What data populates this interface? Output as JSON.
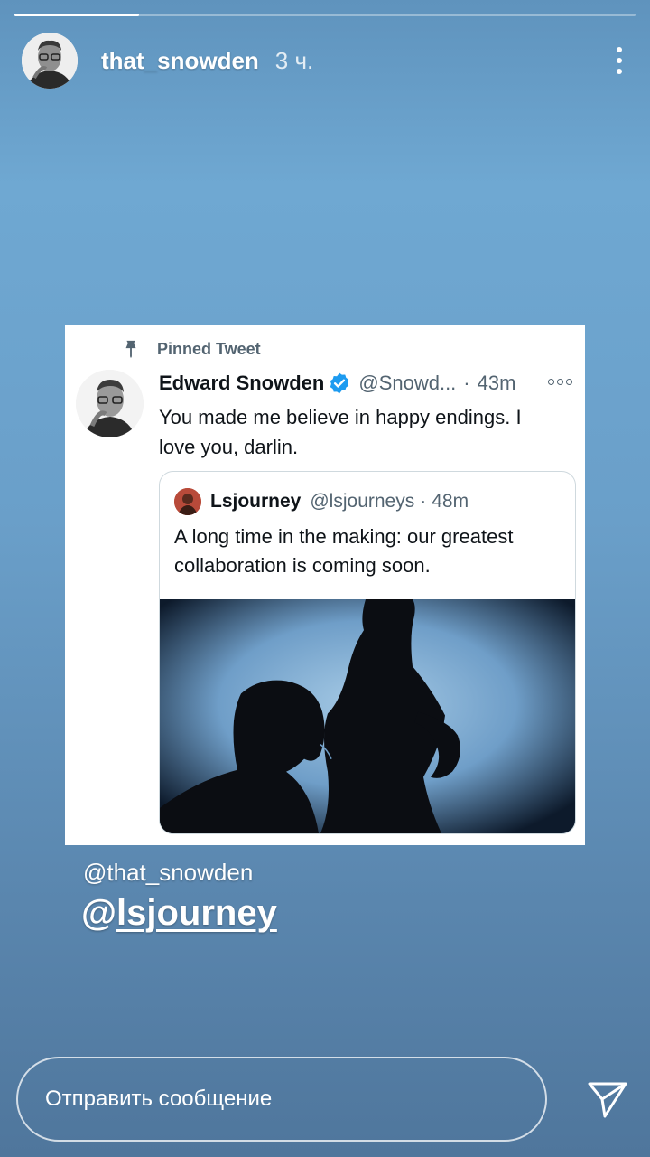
{
  "story": {
    "progress": 0.2
  },
  "header": {
    "username": "that_snowden",
    "time": "3 ч."
  },
  "tweet": {
    "pinned_label": "Pinned Tweet",
    "name": "Edward Snowden",
    "handle": "@Snowd...",
    "dot": "·",
    "time": "43m",
    "text": "You made me believe in happy endings. I love you, darlin.",
    "quote": {
      "name": "Lsjourney",
      "handle": "@lsjourneys",
      "dot": "·",
      "time": "48m",
      "text": "A long time in the making: our greatest collaboration is coming soon."
    }
  },
  "mentions": {
    "first": "@that_snowden",
    "second_prefix": "@",
    "second_name": "lsjourney"
  },
  "footer": {
    "message_placeholder": "Отправить сообщение"
  },
  "icons": {
    "more": "more-vertical-icon",
    "pin": "pin-icon",
    "verified": "verified-badge-icon",
    "tweet_more": "more-horizontal-icon",
    "send": "send-icon"
  },
  "colors": {
    "verified": "#1d9bf0",
    "secondary_text": "#536471",
    "quote_border": "#cfd9de"
  }
}
